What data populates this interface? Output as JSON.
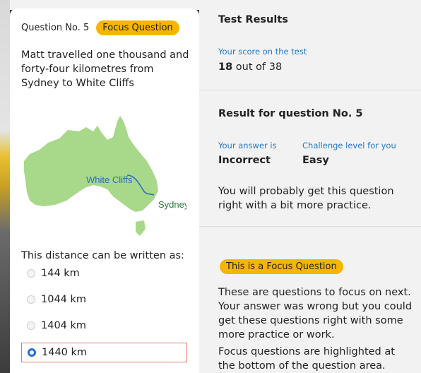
{
  "question": {
    "number_label": "Question No. 5",
    "badge": "Focus Question",
    "text": "Matt travelled one thousand and forty-four kilometres from Sydney to White Cliffs",
    "map": {
      "label_white_cliffs": "White Cliffs",
      "label_sydney": "Sydney",
      "land_color": "#a8d98a",
      "route_color": "#2a6fb8"
    },
    "prompt": "This distance can be written as:",
    "options": [
      {
        "label": "144 km",
        "selected": false
      },
      {
        "label": "1044 km",
        "selected": false
      },
      {
        "label": "1404 km",
        "selected": false
      },
      {
        "label": "1440 km",
        "selected": true
      }
    ]
  },
  "results": {
    "title": "Test Results",
    "score_label": "Your score on the test",
    "score_value": "18",
    "score_rest": " out of 38",
    "question_result_title": "Result for question No. 5",
    "answer_label": "Your answer is",
    "answer_value": "Incorrect",
    "challenge_label": "Challenge level for you",
    "challenge_value": "Easy",
    "practice_note": "You will probably get this question right with a bit more practice.",
    "focus_badge": "This is a Focus Question",
    "focus_note": "These are questions to focus on next. Your answer was wrong but you could get these questions right with some more practice or work.",
    "highlight_note": "Focus questions are highlighted at the bottom of the question area."
  },
  "colors": {
    "accent_yellow": "#f7b500",
    "label_blue": "#1f78c8",
    "selected_radio": "#1f6fd6",
    "selected_border": "#e8786e"
  }
}
